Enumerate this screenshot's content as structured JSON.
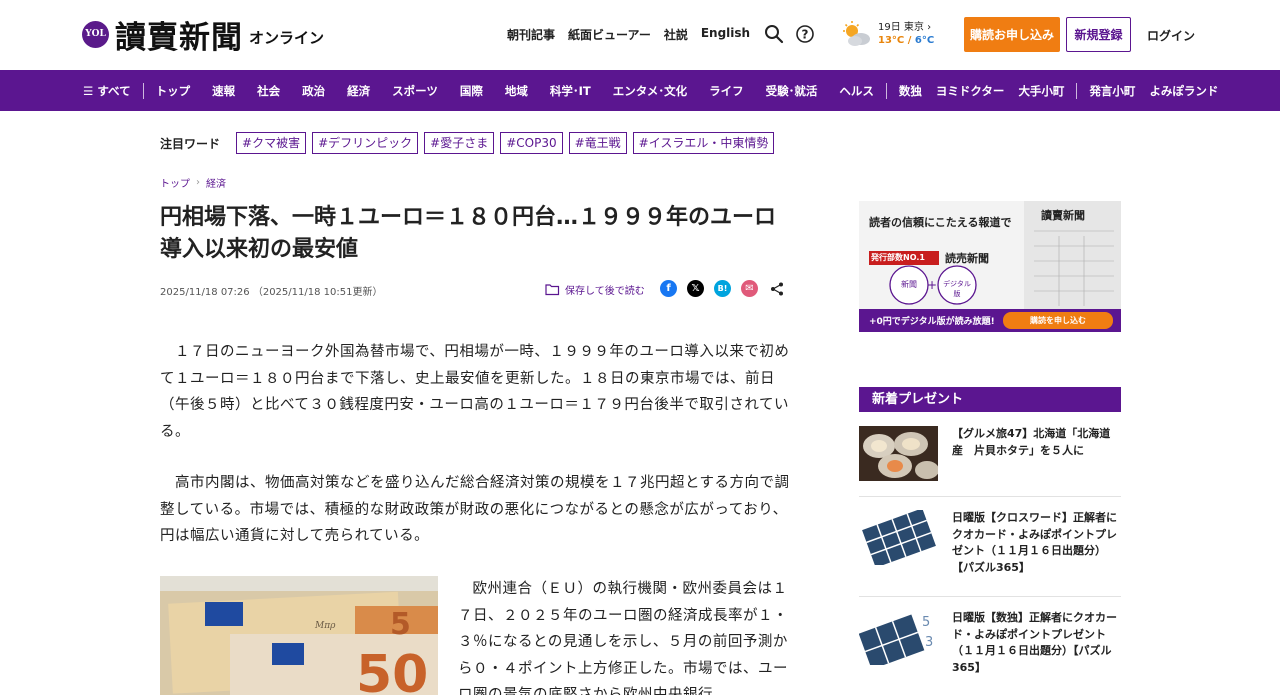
{
  "header": {
    "logo_badge": "YOL",
    "logo_main": "讀賣新聞",
    "logo_sub": "オンライン",
    "util_nav": [
      "朝刊記事",
      "紙面ビューアー",
      "社説",
      "English"
    ],
    "weather": {
      "location": "19日 東京",
      "high": "13°C",
      "low": "6°C",
      "icon": "partly-cloudy-icon"
    },
    "subscribe_label": "購読お申し込み",
    "register_label": "新規登録",
    "login_label": "ログイン"
  },
  "category_nav": {
    "all_label": "すべて",
    "items": [
      "トップ",
      "速報",
      "社会",
      "政治",
      "経済",
      "スポーツ",
      "国際",
      "地域",
      "科学･IT",
      "エンタメ･文化",
      "ライフ",
      "受験･就活",
      "ヘルス"
    ],
    "items2": [
      "数独",
      "ヨミドクター",
      "大手小町"
    ],
    "items3": [
      "発言小町",
      "よみぽランド"
    ]
  },
  "trending": {
    "label": "注目ワード",
    "tags": [
      "#クマ被害",
      "#デフリンピック",
      "#愛子さま",
      "#COP30",
      "#竜王戦",
      "#イスラエル・中東情勢"
    ]
  },
  "breadcrumb": [
    "トップ",
    "経済"
  ],
  "article": {
    "title": "円相場下落、一時１ユーロ＝１８０円台…１９９９年のユーロ導入以来初の最安値",
    "published": "2025/11/18 07:26",
    "updated": "（2025/11/18 10:51更新）",
    "save_later": "保存して後で読む",
    "paragraph1": "　１７日のニューヨーク外国為替市場で、円相場が一時、１９９９年のユーロ導入以来で初めて１ユーロ＝１８０円台まで下落し、史上最安値を更新した。１８日の東京市場では、前日（午後５時）と比べて３０銭程度円安・ユーロ高の１ユーロ＝１７９円台後半で取引されている。",
    "paragraph2": "　高市内閣は、物価高対策などを盛り込んだ総合経済対策の規模を１７兆円超とする方向で調整している。市場では、積極的な財政政策が財政の悪化につながるとの懸念が広がっており、円は幅広い通貨に対して売られている。",
    "paragraph3": "欧州連合（ＥＵ）の執行機関・欧州委員会は１７日、２０２５年のユーロ圏の経済成長率が１・３％になるとの見通しを示し、５月の前回予測から０・４ポイント上方修正した。市場では、ユーロ圏の景気の底堅さから欧州中央銀行"
  },
  "ad": {
    "headline": "読者の信頼にこたえる報道で",
    "badge": "発行部数NO.1",
    "paper": "読売新聞",
    "circle1": "新聞",
    "circle2": "デジタル版",
    "masthead": "讀賣新聞",
    "bottom_text": "+0円でデジタル版が読み放題!",
    "bottom_button": "購読を申し込む"
  },
  "presents": {
    "heading": "新着プレゼント",
    "items": [
      {
        "text": "【グルメ旅47】北海道「北海道産　片貝ホタテ」を５人に",
        "icon": "scallop-photo"
      },
      {
        "text": "日曜版【クロスワード】正解者にクオカード・よみぽポイントプレゼント（１１月１６日出題分）【パズル365】",
        "icon": "crossword-icon"
      },
      {
        "text": "日曜版【数独】正解者にクオカード・よみぽポイントプレゼント（１１月１６日出題分）【パズル365】",
        "icon": "sudoku-icon"
      }
    ]
  },
  "colors": {
    "brand": "#5b1690",
    "accent": "#f07d12"
  }
}
